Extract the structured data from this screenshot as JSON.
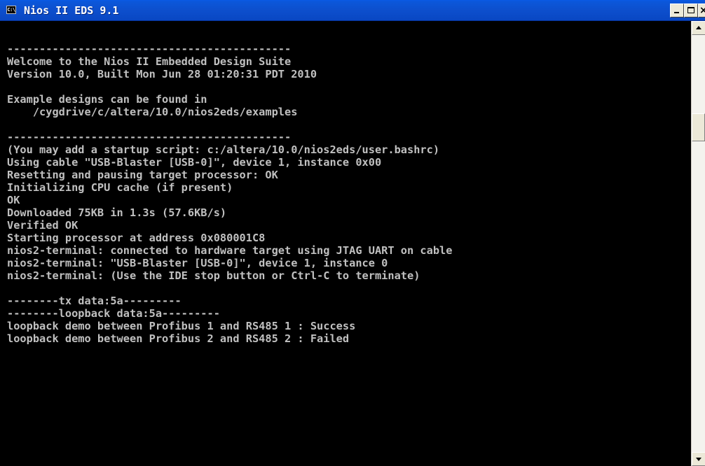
{
  "window": {
    "title": "Nios II EDS 9.1",
    "app_icon": "console-icon",
    "icon_glyph": "C:\\"
  },
  "controls": {
    "minimize_icon": "minimize-icon",
    "maximize_icon": "maximize-icon",
    "close_icon": "close-icon"
  },
  "colors": {
    "titlebar": "#0d4fcd",
    "console_background": "#000000",
    "console_text": "#c0c0c0"
  },
  "console": {
    "lines": [
      "--------------------------------------------",
      "Welcome to the Nios II Embedded Design Suite",
      "Version 10.0, Built Mon Jun 28 01:20:31 PDT 2010",
      "",
      "Example designs can be found in",
      "    /cygdrive/c/altera/10.0/nios2eds/examples",
      "",
      "--------------------------------------------",
      "(You may add a startup script: c:/altera/10.0/nios2eds/user.bashrc)",
      "Using cable \"USB-Blaster [USB-0]\", device 1, instance 0x00",
      "Resetting and pausing target processor: OK",
      "Initializing CPU cache (if present)",
      "OK",
      "Downloaded 75KB in 1.3s (57.6KB/s)",
      "Verified OK",
      "Starting processor at address 0x080001C8",
      "nios2-terminal: connected to hardware target using JTAG UART on cable",
      "nios2-terminal: \"USB-Blaster [USB-0]\", device 1, instance 0",
      "nios2-terminal: (Use the IDE stop button or Ctrl-C to terminate)",
      "",
      "--------tx data:5a---------",
      "--------loopback data:5a---------",
      "loopback demo between Profibus 1 and RS485 1 : Success",
      "loopback demo between Profibus 2 and RS485 2 : Failed"
    ]
  },
  "scrollbar": {
    "up_icon": "scroll-up-arrow-icon",
    "down_icon": "scroll-down-arrow-icon"
  }
}
